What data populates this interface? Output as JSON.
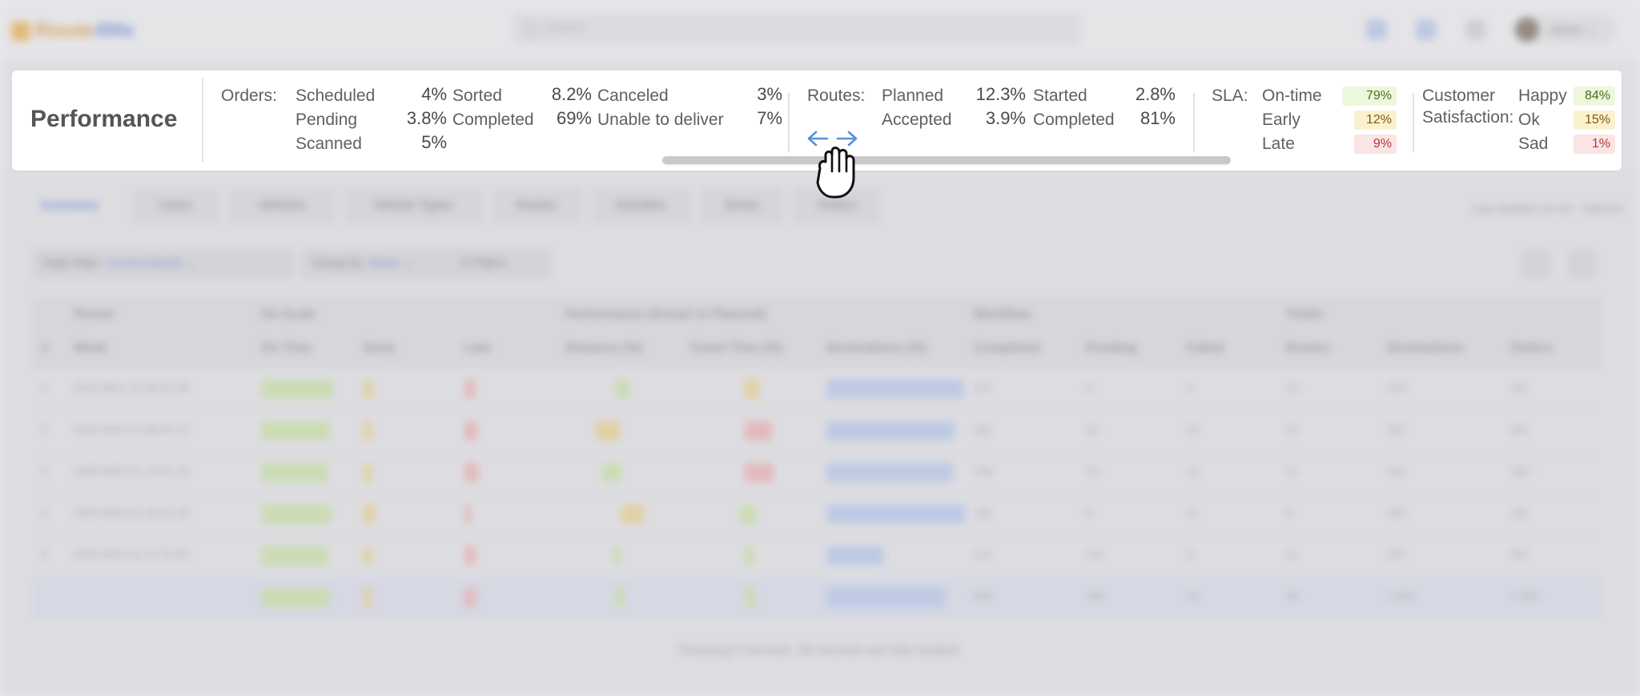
{
  "performance": {
    "title": "Performance",
    "orders": {
      "label": "Orders:",
      "items": [
        {
          "label": "Scheduled",
          "value": "4%"
        },
        {
          "label": "Pending",
          "value": "3.8%"
        },
        {
          "label": "Scanned",
          "value": "5%"
        },
        {
          "label": "Sorted",
          "value": "8.2%"
        },
        {
          "label": "Completed",
          "value": "69%"
        },
        {
          "label": "Canceled",
          "value": "3%"
        },
        {
          "label": "Unable to deliver",
          "value": "7%"
        }
      ]
    },
    "routes": {
      "label": "Routes:",
      "items": [
        {
          "label": "Planned",
          "value": "12.3%"
        },
        {
          "label": "Accepted",
          "value": "3.9%"
        },
        {
          "label": "Started",
          "value": "2.8%"
        },
        {
          "label": "Completed",
          "value": "81%"
        }
      ]
    },
    "sla": {
      "label": "SLA:",
      "items": [
        {
          "label": "On-time",
          "value": "79%"
        },
        {
          "label": "Early",
          "value": "12%"
        },
        {
          "label": "Late",
          "value": "9%"
        }
      ]
    },
    "satisfaction": {
      "label_line1": "Customer",
      "label_line2": "Satisfaction:",
      "items": [
        {
          "label": "Happy",
          "value": "84%"
        },
        {
          "label": "Ok",
          "value": "15%"
        },
        {
          "label": "Sad",
          "value": "1%"
        }
      ]
    }
  },
  "colors": {
    "accent": "#5b7be0",
    "badge_green": "#edf7dc",
    "badge_yellow": "#fcf1cf",
    "badge_red": "#fbe4e4"
  },
  "cursor": {
    "icon": "grab-hand-cursor-icon",
    "arrows": "left-right-arrows-icon"
  }
}
